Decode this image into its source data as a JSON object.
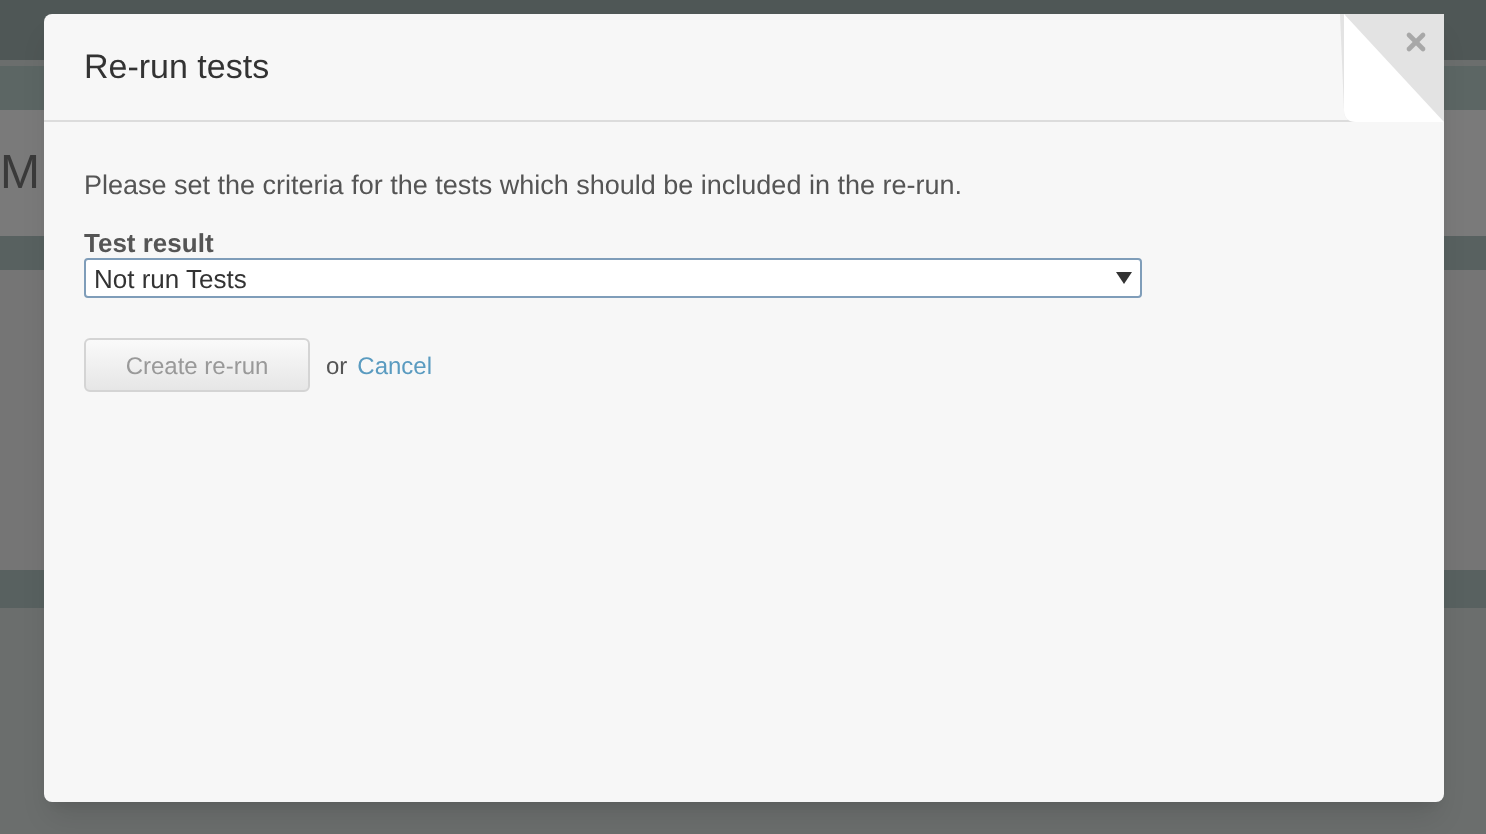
{
  "background": {
    "heading": "M"
  },
  "dialog": {
    "title": "Re-run tests",
    "intro": "Please set the criteria for the tests which should be included in the re-run.",
    "field": {
      "label": "Test result",
      "value": "Not run Tests"
    },
    "submit": {
      "label": "Create re-run",
      "disabled": true
    },
    "separator": "or",
    "cancel": "Cancel"
  }
}
